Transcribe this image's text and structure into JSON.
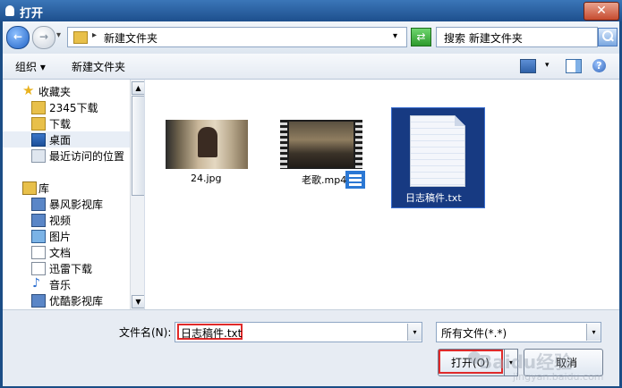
{
  "window": {
    "title": "打开",
    "close_glyph": "✕"
  },
  "address_bar": {
    "back_glyph": "←",
    "forward_glyph": "→",
    "path_separator": "▸",
    "path": "新建文件夹",
    "dropdown_glyph": "▾",
    "refresh_glyph": "⇄",
    "search_placeholder": "搜索 新建文件夹"
  },
  "toolbar": {
    "organize_label": "组织 ▾",
    "new_folder_label": "新建文件夹",
    "view_dropdown_glyph": "▾",
    "help_glyph": "?"
  },
  "sidebar": {
    "scroll_up": "▲",
    "scroll_down": "▼",
    "items": [
      {
        "label": "收藏夹",
        "icon": "star-icon"
      },
      {
        "label": "2345下载",
        "icon": "folder-icon"
      },
      {
        "label": "下载",
        "icon": "download-folder-icon"
      },
      {
        "label": "桌面",
        "icon": "desktop-icon",
        "selected": true
      },
      {
        "label": "最近访问的位置",
        "icon": "recent-places-icon"
      },
      {
        "label": "库",
        "icon": "library-icon"
      },
      {
        "label": "暴风影视库",
        "icon": "video-library-icon"
      },
      {
        "label": "视频",
        "icon": "video-icon"
      },
      {
        "label": "图片",
        "icon": "picture-icon"
      },
      {
        "label": "文档",
        "icon": "document-icon"
      },
      {
        "label": "迅雷下载",
        "icon": "download-icon"
      },
      {
        "label": "音乐",
        "icon": "music-icon"
      },
      {
        "label": "优酷影视库",
        "icon": "video-library-icon"
      }
    ]
  },
  "files": [
    {
      "name": "24.jpg",
      "type": "image"
    },
    {
      "name": "老歌.mp4",
      "type": "video"
    },
    {
      "name": "日志稿件.txt",
      "type": "text",
      "selected": true
    }
  ],
  "bottom": {
    "filename_label": "文件名(N):",
    "filename_value": "日志稿件.txt",
    "filetype_value": "所有文件(*.*)",
    "dropdown_glyph": "▾",
    "open_label": "打开(O)",
    "split_glyph": "▾",
    "cancel_label": "取消"
  },
  "watermark": {
    "top": "Baidu经验",
    "bottom": "jingyan.baidu.com"
  }
}
